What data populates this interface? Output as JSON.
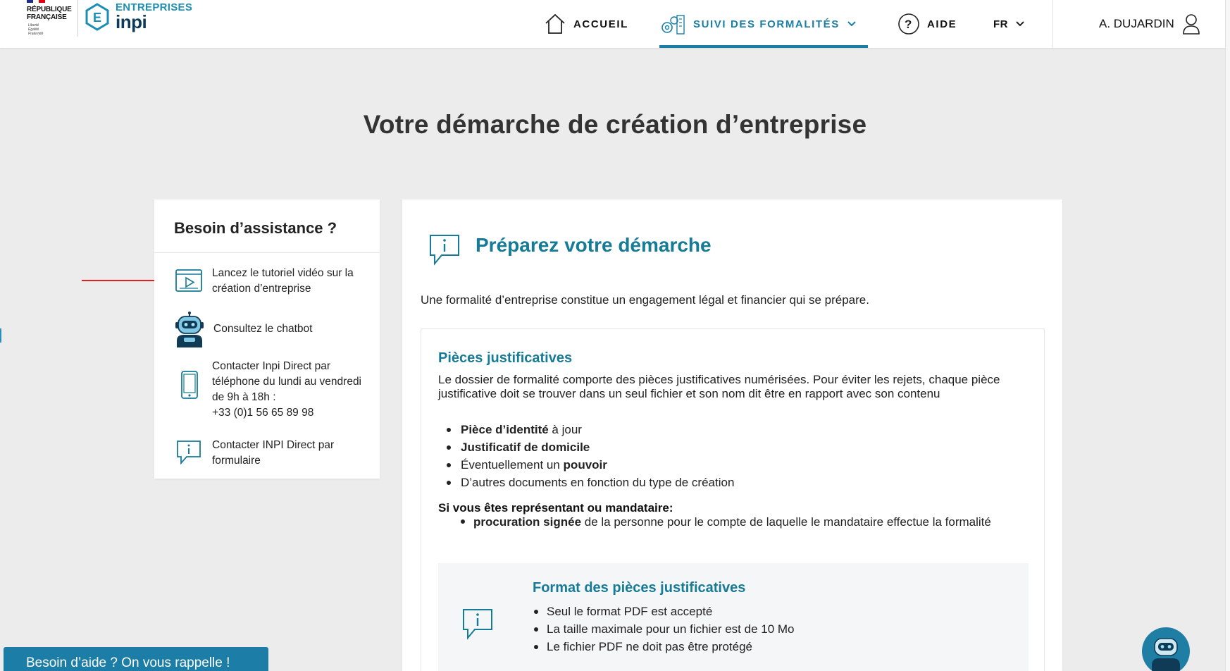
{
  "header": {
    "republic_line1": "RÉPUBLIQUE",
    "republic_line2": "FRANÇAISE",
    "republic_motto": "Liberté Égalité Fraternité",
    "brand_top": "ENTREPRISES",
    "brand_bottom": "inpi",
    "nav": {
      "home": "ACCUEIL",
      "suivi": "SUIVI DES FORMALITÉS",
      "aide": "AIDE",
      "lang": "FR",
      "user": "A. DUJARDIN"
    }
  },
  "page_title": "Votre démarche de création d’entreprise",
  "assistance": {
    "title": "Besoin d’assistance ?",
    "video": "Lancez le tutoriel vidéo sur la création d’entreprise",
    "chatbot": "Consultez le chatbot",
    "phone_line1": "Contacter Inpi Direct par téléphone du lundi au vendredi de 9h à 18h :",
    "phone_number": "+33 (0)1 56 65 89 98",
    "form": "Contacter INPI Direct par formulaire"
  },
  "main": {
    "title": "Préparez votre démarche",
    "intro": "Une formalité d’entreprise constitue un engagement légal et financier qui se prépare.",
    "pieces": {
      "title": "Pièces justificatives",
      "description": "Le dossier de formalité comporte des pièces justificatives numérisées. Pour éviter les rejets, chaque pièce justificative doit se trouver dans un seul fichier et son nom dit être en rapport avec son contenu",
      "items": [
        {
          "bold": "Pièce d’identité",
          "rest": " à jour",
          "prefix": ""
        },
        {
          "bold": "Justificatif de domicile",
          "rest": "",
          "prefix": ""
        },
        {
          "prefix": "Éventuellement un ",
          "bold": "pouvoir",
          "rest": ""
        },
        {
          "prefix": "D’autres documents en fonction du type de création",
          "bold": "",
          "rest": ""
        }
      ],
      "rep_title": "Si vous êtes représentant ou mandataire:",
      "rep_bold": "procuration signée",
      "rep_rest": " de la personne pour le compte de laquelle le mandataire effectue la formalité"
    },
    "format": {
      "title": "Format des pièces justificatives",
      "items": [
        "Seul le format PDF est accepté",
        "La taille maximale pour un fichier est de 10 Mo",
        "Le fichier PDF ne doit pas être protégé"
      ]
    }
  },
  "callback_label": "Besoin d’aide ? On vous rappelle !",
  "colors": {
    "accent": "#167b97",
    "nav_active": "#1a7fa6",
    "callback_bg": "#1c7ea6",
    "annotation_arrow": "#e02020"
  },
  "icons": {
    "home": "home-icon",
    "suivi": "gears-building-icon",
    "aide": "question-circle-icon",
    "user": "user-icon",
    "video": "video-player-icon",
    "chatbot": "robot-icon",
    "phone": "phone-icon",
    "form": "info-bubble-icon"
  }
}
